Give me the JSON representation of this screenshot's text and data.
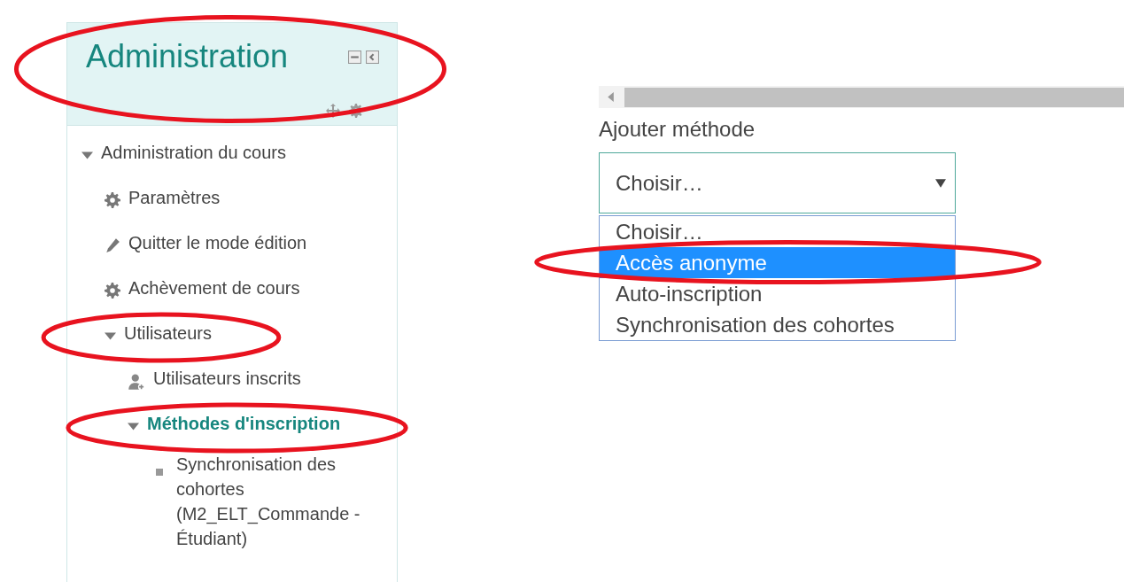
{
  "block": {
    "title": "Administration",
    "circled": true
  },
  "tree": [
    {
      "label": "Administration du cours",
      "kind": "section",
      "expanded": true,
      "current": false,
      "circled": false,
      "children": [
        {
          "label": "Paramètres",
          "kind": "settings",
          "current": false,
          "circled": false
        },
        {
          "label": "Quitter le mode édition",
          "kind": "edit",
          "current": false,
          "circled": false
        },
        {
          "label": "Achèvement de cours",
          "kind": "settings",
          "current": false,
          "circled": false
        },
        {
          "label": "Utilisateurs",
          "kind": "section",
          "expanded": true,
          "current": false,
          "circled": true,
          "children": [
            {
              "label": "Utilisateurs inscrits",
              "kind": "users",
              "current": false,
              "circled": false
            },
            {
              "label": "Méthodes d'inscription",
              "kind": "section",
              "expanded": true,
              "current": true,
              "circled": true,
              "children": [
                {
                  "label": "Synchronisation des cohortes (M2_ELT_Commande - Étudiant)",
                  "kind": "leaf",
                  "current": false,
                  "circled": false
                }
              ]
            }
          ]
        }
      ]
    }
  ],
  "enrol": {
    "label": "Ajouter méthode",
    "select": {
      "value": "Choisir…",
      "expanded": true
    },
    "options": [
      {
        "label": "Choisir…",
        "selected": false,
        "circled": false
      },
      {
        "label": "Accès anonyme",
        "selected": true,
        "circled": true
      },
      {
        "label": "Auto-inscription",
        "selected": false,
        "circled": false
      },
      {
        "label": "Synchronisation des cohortes",
        "selected": false,
        "circled": false
      }
    ]
  }
}
